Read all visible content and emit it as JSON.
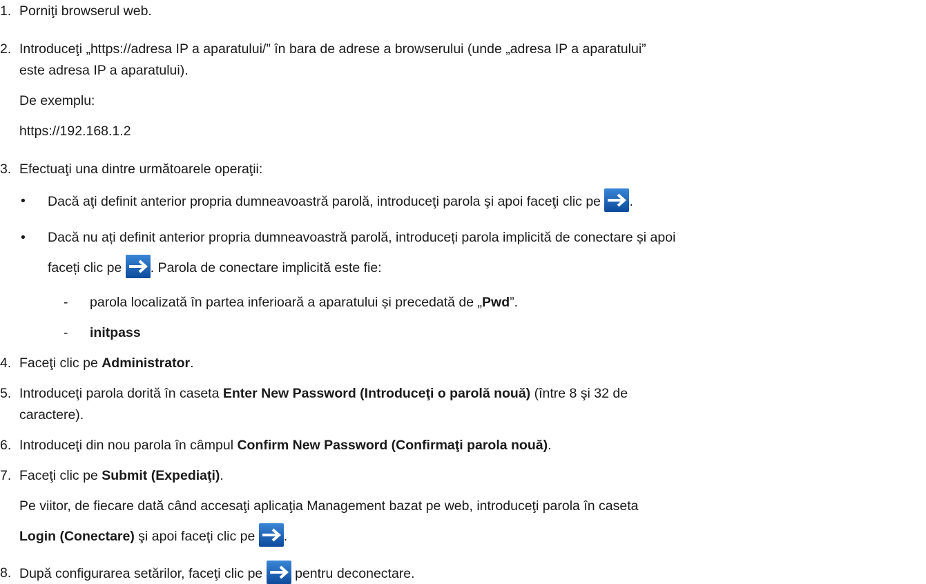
{
  "steps": {
    "s1": {
      "num": "1.",
      "text": "Porniţi browserul web."
    },
    "s2": {
      "num": "2.",
      "line1": "Introduceţi „https://adresa IP a aparatului/” în bara de adrese a browserului (unde „adresa IP a aparatului”",
      "line2": "este adresa IP a aparatului).",
      "example_label": "De exemplu:",
      "example_url": "https://192.168.1.2"
    },
    "s3": {
      "num": "3.",
      "text": "Efectuaţi una dintre următoarele operaţii:",
      "bullet1": "Dacă aţi definit anterior propria dumneavoastră parolă, introduceţi parola şi apoi faceţi clic pe",
      "bullet1_end": ".",
      "bullet2_line1": "Dacă nu ați definit anterior propria dumneavoastră parolă, introduceți parola implicită de conectare și apoi",
      "bullet2_line2a": "faceți clic pe",
      "bullet2_line2b": ". Parola de conectare implicită este fie:",
      "sub1_a": "parola localizată în partea inferioară a aparatului și precedată de „",
      "sub1_bold": "Pwd",
      "sub1_b": "”.",
      "sub2_bold": "initpass"
    },
    "s4": {
      "num": "4.",
      "a": "Faceţi clic pe ",
      "bold": "Administrator",
      "b": "."
    },
    "s5": {
      "num": "5.",
      "a": "Introduceţi parola dorită în caseta ",
      "bold": "Enter New Password (Introduceţi o parolă nouă)",
      "b": " (între 8 şi 32 de",
      "line2": "caractere)."
    },
    "s6": {
      "num": "6.",
      "a": "Introduceţi din nou parola în câmpul ",
      "bold": "Confirm New Password (Confirmaţi parola nouă)",
      "b": "."
    },
    "s7": {
      "num": "7.",
      "a": "Faceţi clic pe ",
      "bold": "Submit (Expediaţi)",
      "b": ".",
      "note_line1": "Pe viitor, de fiecare dată când accesaţi aplicaţia Management bazat pe web, introduceţi parola în caseta",
      "note_bold": "Login (Conectare)",
      "note_line2": " şi apoi faceţi clic pe ",
      "note_end": "."
    },
    "s8": {
      "num": "8.",
      "a": "După configurarea setărilor, faceţi clic pe ",
      "b": " pentru deconectare."
    }
  },
  "icons": {
    "arrow": "login-arrow-icon",
    "arrow_bg": "#1a5fb4",
    "arrow_fg": "#ffffff"
  },
  "bullet_char": "•",
  "dash_char": "-"
}
